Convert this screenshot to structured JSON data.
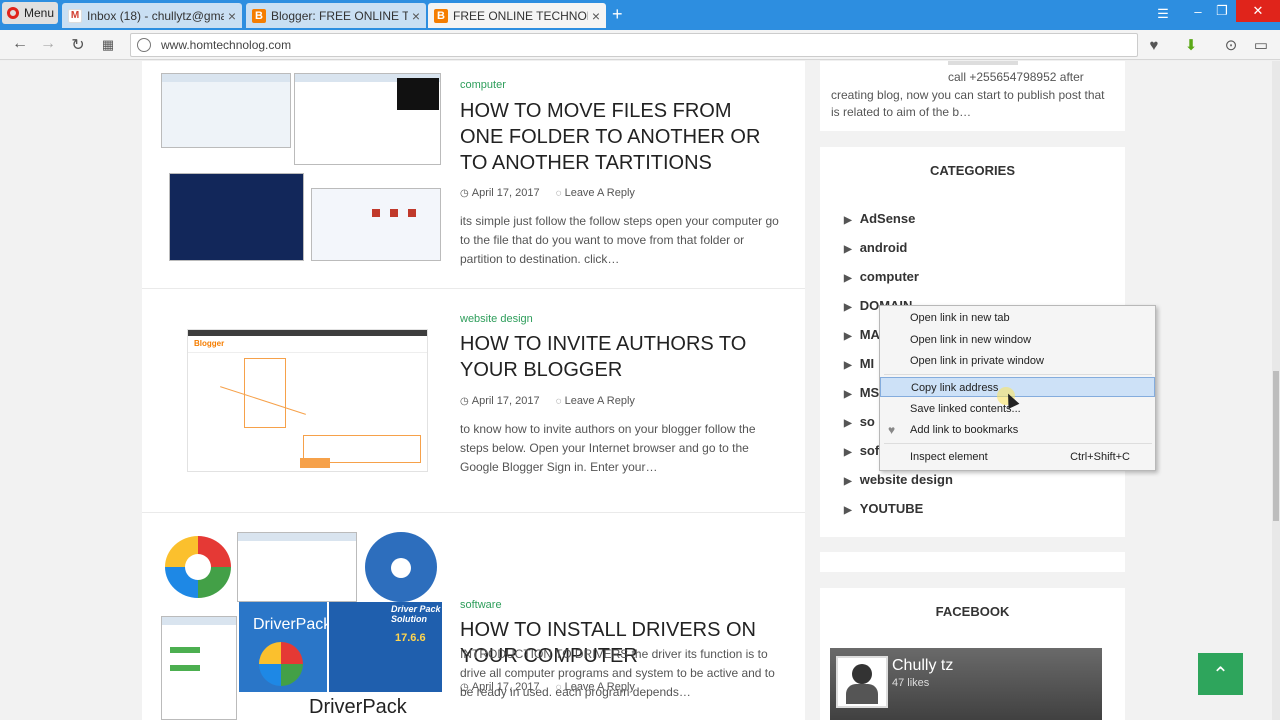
{
  "browser": {
    "menu_label": "Menu",
    "tabs": [
      {
        "title": "Inbox (18) - chullytz@gma",
        "favicon": "gmail-icon"
      },
      {
        "title": "Blogger: FREE ONLINE TEC",
        "favicon": "blogger-icon"
      },
      {
        "title": "FREE ONLINE TECHNOLOG",
        "favicon": "blogger-icon",
        "active": true
      }
    ],
    "url": "www.homtechnolog.com"
  },
  "posts": [
    {
      "category": "computer",
      "title": "HOW TO MOVE FILES FROM ONE FOLDER TO ANOTHER OR TO ANOTHER TARTITIONS",
      "date": "April 17, 2017",
      "reply": "Leave A Reply",
      "excerpt": "its simple just follow the follow steps open your computer go to the file that do you want to move from that folder or partition to destination. click…"
    },
    {
      "category": "website design",
      "title": "HOW TO INVITE AUTHORS TO YOUR BLOGGER",
      "date": "April 17, 2017",
      "reply": "Leave A Reply",
      "excerpt": "to know how to invite authors on your blogger follow the steps below. Open your Internet browser and go to the Google Blogger Sign in. Enter your…"
    },
    {
      "category": "software",
      "title": "HOW TO INSTALL DRIVERS ON YOUR COMPUTER",
      "date": "April 17, 2017",
      "reply": "Leave A Reply",
      "excerpt": "INTRODUCTION TO DRIVERS the driver its function is to drive all computer programs and system to be active and to be ready in used. each program depends…"
    }
  ],
  "thumb_text": {
    "blogger_logo": "Blogger",
    "driverpack": "DriverPack",
    "driverpack_solution": "Driver Pack Solution",
    "driverpack_version": "17.6.6"
  },
  "sidebar": {
    "about_text_line1": "call +255654798952 after",
    "about_text_rest": "creating blog, now you can start to publish post that is related to aim of the b…",
    "categories_title": "CATEGORIES",
    "categories": [
      "AdSense",
      "android",
      "computer",
      "DOMAIN",
      "MA",
      "MI",
      "MS",
      "so",
      "sof",
      "website design",
      "YOUTUBE"
    ],
    "facebook_title": "FACEBOOK",
    "facebook_name": "Chully tz",
    "facebook_likes": "47 likes"
  },
  "context_menu": {
    "items": [
      {
        "label": "Open link in new tab"
      },
      {
        "label": "Open link in new window"
      },
      {
        "label": "Open link in private window"
      },
      {
        "label": "Copy link address",
        "highlighted": true
      },
      {
        "label": "Save linked contents..."
      },
      {
        "label": "Add link to bookmarks"
      },
      {
        "label": "Inspect element",
        "shortcut": "Ctrl+Shift+C"
      }
    ]
  },
  "colors": {
    "accent_green": "#2ea55c",
    "tabbar_blue": "#2d8ee0",
    "category_green": "#2e9e5b"
  }
}
